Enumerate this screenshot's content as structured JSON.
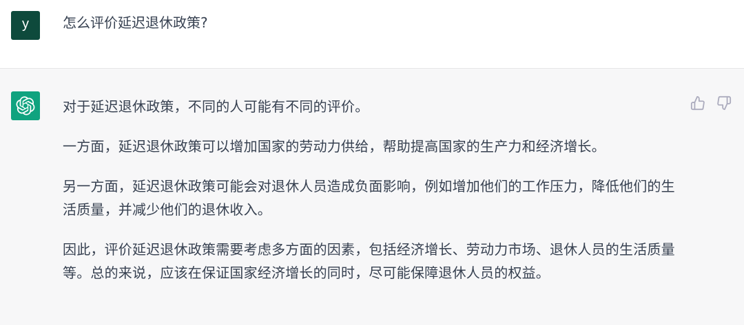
{
  "user_message": {
    "avatar_letter": "y",
    "avatar_color": "#0e4a3c",
    "text": "怎么评价延迟退休政策?"
  },
  "assistant_message": {
    "avatar_icon": "openai-logo-icon",
    "avatar_color": "#10a37f",
    "paragraphs": [
      "对于延迟退休政策，不同的人可能有不同的评价。",
      "一方面，延迟退休政策可以增加国家的劳动力供给，帮助提高国家的生产力和经济增长。",
      "另一方面，延迟退休政策可能会对退休人员造成负面影响，例如增加他们的工作压力，降低他们的生活质量，并减少他们的退休收入。",
      "因此，评价延迟退休政策需要考虑多方面的因素，包括经济增长、劳动力市场、退休人员的生活质量等。总的来说，应该在保证国家经济增长的同时，尽可能保障退休人员的权益。"
    ],
    "actions": {
      "thumbs_up_icon": "thumbs-up-icon",
      "thumbs_down_icon": "thumbs-down-icon"
    }
  },
  "colors": {
    "assistant_bg": "#f7f7f8",
    "text": "#374151",
    "icon": "#acacbe"
  }
}
